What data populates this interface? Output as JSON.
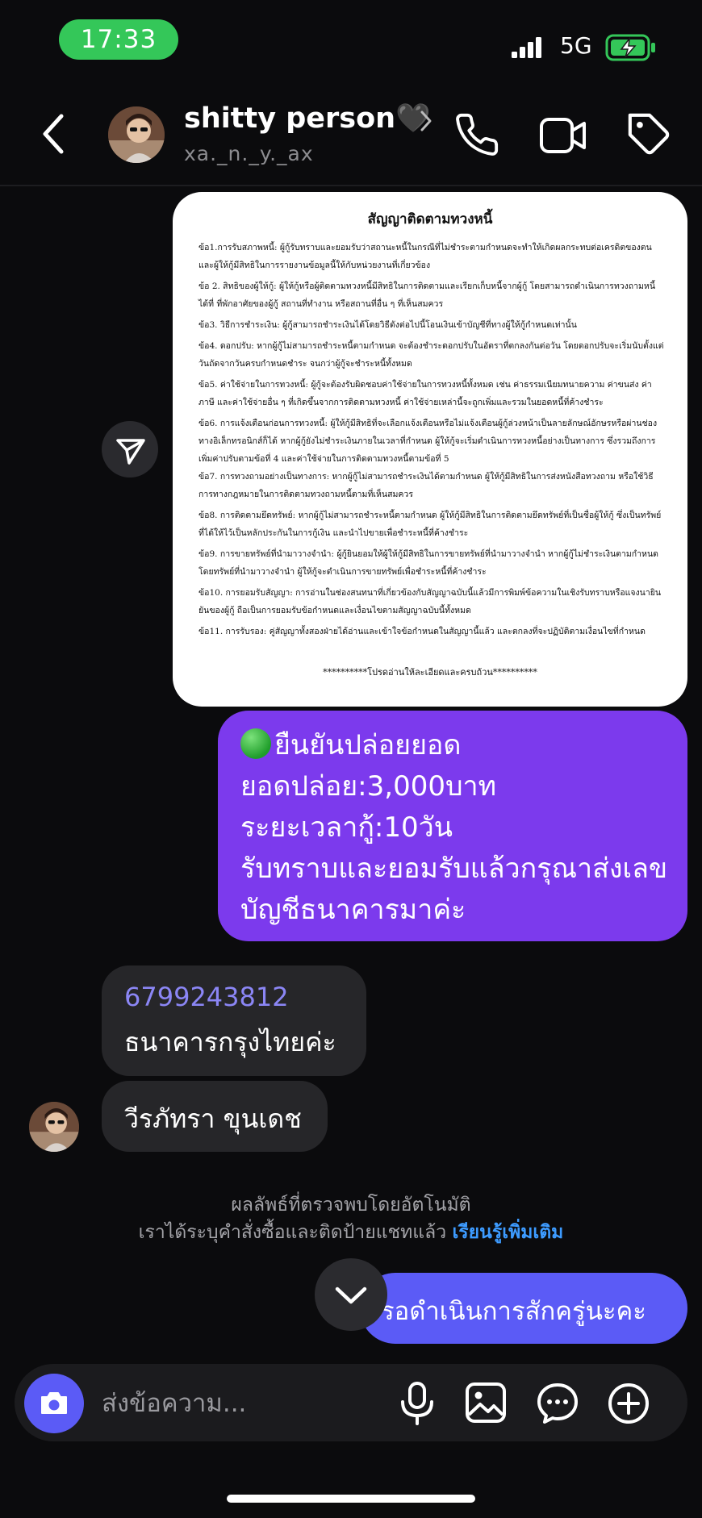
{
  "status_bar": {
    "time": "17:33",
    "network": "5G",
    "accent": "#34c759"
  },
  "header": {
    "name": "shitty person",
    "heart": "🖤",
    "handle": "xa._n._y._ax",
    "icons": [
      "back-icon",
      "chevron-right-icon",
      "phone-icon",
      "video-icon",
      "tag-icon"
    ]
  },
  "document": {
    "title": "สัญญาติดตามทวงหนี้",
    "clauses": [
      "ข้อ1.การรับสภาพหนี้: ผู้กู้รับทราบและยอมรับว่าสถานะหนี้ในกรณีที่ไม่ชำระตามกำหนดจะทำให้เกิดผลกระทบต่อเครดิตของตน และผู้ให้กู้มีสิทธิในการรายงานข้อมูลนี้ให้กับหน่วยงานที่เกี่ยวข้อง",
      "ข้อ 2. สิทธิของผู้ให้กู้: ผู้ให้กู้หรือผู้ติดตามทวงหนี้มีสิทธิในการติดตามและเรียกเก็บหนี้จากผู้กู้ โดยสามารถดำเนินการทวงถามหนี้ได้ที่ ที่พักอาศัยของผู้กู้ สถานที่ทำงาน หรือสถานที่อื่น ๆ ที่เห็นสมควร",
      "ข้อ3. วิธีการชำระเงิน: ผู้กู้สามารถชำระเงินได้โดยวิธีดังต่อไปนี้โอนเงินเข้าบัญชีที่ทางผู้ให้กู้กำหนดเท่านั้น",
      "ข้อ4. ดอกปรับ: หากผู้กู้ไม่สามารถชำระหนี้ตามกำหนด จะต้องชำระดอกปรับในอัตราที่ตกลงกันต่อวัน โดยดอกปรับจะเริ่มนับตั้งแต่วันถัดจากวันครบกำหนดชำระ จนกว่าผู้กู้จะชำระหนี้ทั้งหมด",
      "ข้อ5. ค่าใช้จ่ายในการทวงหนี้: ผู้กู้จะต้องรับผิดชอบค่าใช้จ่ายในการทวงหนี้ทั้งหมด เช่น ค่าธรรมเนียมทนายความ ค่าขนส่ง ค่าภาษี และค่าใช้จ่ายอื่น ๆ ที่เกิดขึ้นจากการติดตามทวงหนี้ ค่าใช้จ่ายเหล่านี้จะถูกเพิ่มและรวมในยอดหนี้ที่ค้างชำระ",
      "ข้อ6. การแจ้งเตือนก่อนการทวงหนี้: ผู้ให้กู้มีสิทธิที่จะเลือกแจ้งเตือนหรือไม่แจ้งเตือนผู้กู้ล่วงหน้าเป็นลายลักษณ์อักษรหรือผ่านช่องทางอิเล็กทรอนิกส์ก็ได้ หากผู้กู้ยังไม่ชำระเงินภายในเวลาที่กำหนด ผู้ให้กู้จะเริ่มดำเนินการทวงหนี้อย่างเป็นทางการ ซึ่งรวมถึงการเพิ่มค่าปรับตามข้อที่ 4 และค่าใช้จ่ายในการติดตามทวงหนี้ตามข้อที่ 5",
      "ข้อ7. การทวงถามอย่างเป็นทางการ: หากผู้กู้ไม่สามารถชำระเงินได้ตามกำหนด ผู้ให้กู้มีสิทธิในการส่งหนังสือทวงถาม หรือใช้วิธีการทางกฎหมายในการติดตามทวงถามหนี้ตามที่เห็นสมควร",
      "ข้อ8. การติดตามยึดทรัพย์: หากผู้กู้ไม่สามารถชำระหนี้ตามกำหนด ผู้ให้กู้มีสิทธิในการติดตามยึดทรัพย์ที่เป็นชื่อผู้ให้กู้ ซึ่งเป็นทรัพย์ที่ได้ให้ไว้เป็นหลักประกันในการกู้เงิน และนำไปขายเพื่อชำระหนี้ที่ค้างชำระ",
      "ข้อ9. การขายทรัพย์ที่นำมาวางจำนำ: ผู้กู้ยินยอมให้ผู้ให้กู้มีสิทธิในการขายทรัพย์ที่นำมาวางจำนำ หากผู้กู้ไม่ชำระเงินตามกำหนด โดยทรัพย์ที่นำมาวางจำนำ ผู้ให้กู้จะดำเนินการขายทรัพย์เพื่อชำระหนี้ที่ค้างชำระ",
      "ข้อ10. การยอมรับสัญญา: การอ่านในช่องสนทนาที่เกี่ยวข้องกับสัญญาฉบับนี้แล้วมีการพิมพ์ข้อความในเชิงรับทราบหรือแจงนายินยันของผู้กู้ ถือเป็นการยอมรับข้อกำหนดและเงื่อนไขตามสัญญาฉบับนี้ทั้งหมด",
      "ข้อ11. การรับรอง: คู่สัญญาทั้งสองฝ่ายได้อ่านและเข้าใจข้อกำหนดในสัญญานี้แล้ว และตกลงที่จะปฏิบัติตามเงื่อนไขที่กำหนด"
    ],
    "footer": "**********โปรดอ่านให้ละเอียดและครบถ้วน**********"
  },
  "outgoing_message": {
    "line1": "ยืนยันปล่อยยอด",
    "line2": "ยอดปล่อย:3,000บาท",
    "line3": "ระยะเวลากู้:10วัน",
    "line4": "รับทราบและยอมรับแล้วกรุณาส่งเลข",
    "line5": "บัญชีธนาคารมาค่ะ",
    "bubble_color": "#7c3aed"
  },
  "incoming_messages": {
    "account_number": "6799243812",
    "bank": "ธนาคารกรุงไทยค่ะ",
    "account_name": "วีรภัทรา ขุนเดช"
  },
  "system_notice": {
    "line1": "ผลลัพธ์ที่ตรวจพบโดยอัตโนมัติ",
    "line2": "เราได้ระบุคำสั่งซื้อและติดป้ายแชทแล้ว",
    "link": "เรียนรู้เพิ่มเติม"
  },
  "last_outgoing": {
    "text": "รอดำเนินการสักครู่นะคะ",
    "bubble_color": "#5b5bf6"
  },
  "composer": {
    "placeholder": "ส่งข้อความ...",
    "icons": [
      "camera-icon",
      "microphone-icon",
      "gallery-icon",
      "sticker-icon",
      "plus-icon"
    ]
  }
}
